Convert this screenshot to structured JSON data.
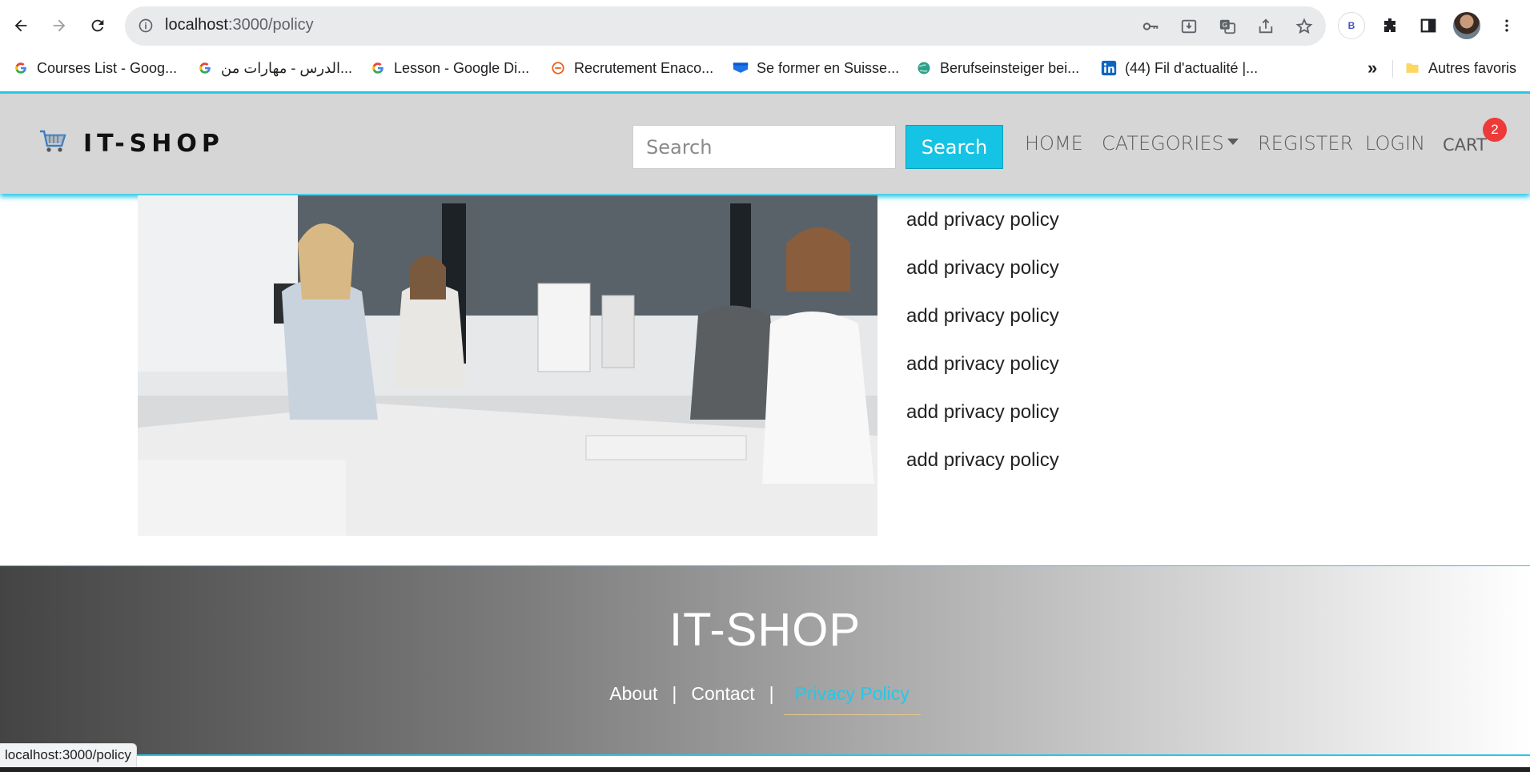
{
  "browser": {
    "url_host": "localhost",
    "url_path": ":3000/policy",
    "bookmarks": [
      {
        "label": "Courses List - Goog...",
        "icon": "google-icon"
      },
      {
        "label": "الدرس - مهارات من...",
        "icon": "google-icon"
      },
      {
        "label": "Lesson - Google Di...",
        "icon": "google-icon"
      },
      {
        "label": "Recrutement Enaco...",
        "icon": "e-logo-icon"
      },
      {
        "label": "Se former en Suisse...",
        "icon": "flag-icon"
      },
      {
        "label": "Berufseinsteiger bei...",
        "icon": "globe-icon"
      },
      {
        "label": "(44) Fil d'actualité |...",
        "icon": "linkedin-icon"
      }
    ],
    "more_label": "»",
    "other_bookmarks": "Autres favoris",
    "profile_letter": "B",
    "status_url": "localhost:3000/policy"
  },
  "header": {
    "brand": "IT-SHOP",
    "search_placeholder": "Search",
    "search_button": "Search",
    "nav": {
      "home": "HOME",
      "categories": "CATEGORIES",
      "register": "REGISTER",
      "login": "LOGIN",
      "cart": "CART"
    },
    "cart_count": "2"
  },
  "main": {
    "policy_items": [
      "add privacy policy",
      "add privacy policy",
      "add privacy policy",
      "add privacy policy",
      "add privacy policy",
      "add privacy policy"
    ]
  },
  "footer": {
    "title": "IT-SHOP",
    "about": "About",
    "contact": "Contact",
    "privacy": "Privacy Policy",
    "sep": "|"
  },
  "colors": {
    "accent": "#29c6e6",
    "search_button": "#15c3e4",
    "badge": "#ef3a3a",
    "header_bg": "#d6d6d6"
  }
}
